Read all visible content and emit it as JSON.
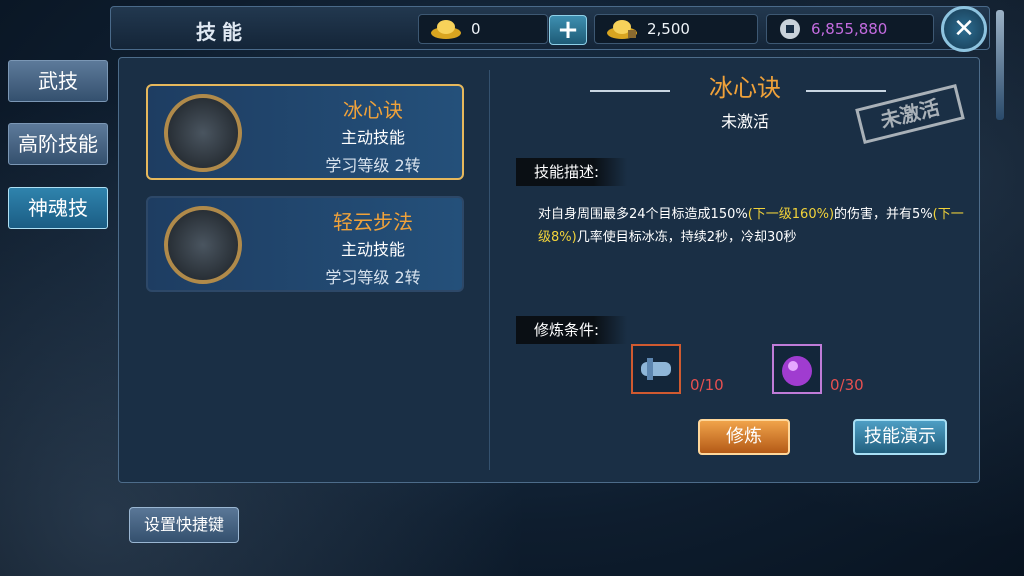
{
  "header": {
    "title": "技能"
  },
  "currency": {
    "ingot": "0",
    "bound_ingot": "2,500",
    "silver": "6,855,880"
  },
  "side_tabs": [
    {
      "label": "武技"
    },
    {
      "label": "高阶技能"
    },
    {
      "label": "神魂技"
    }
  ],
  "skills": [
    {
      "name": "冰心诀",
      "type": "主动技能",
      "level": "学习等级 2转"
    },
    {
      "name": "轻云步法",
      "type": "主动技能",
      "level": "学习等级 2转"
    }
  ],
  "detail": {
    "name": "冰心诀",
    "status": "未激活",
    "stamp": "未激活",
    "desc_label": "技能描述:",
    "desc_p1": "对自身周围最多24个目标造成150%",
    "desc_hl1": "(下一级160%)",
    "desc_p2": "的伤害，并有5%",
    "desc_hl2": "(下一级8%)",
    "desc_p3": "几率使目标冰冻，持续2秒，冷却30秒",
    "cond_label": "修炼条件:",
    "items": [
      {
        "count": "0/10"
      },
      {
        "count": "0/30"
      }
    ]
  },
  "buttons": {
    "train": "修炼",
    "demo": "技能演示",
    "hotkey": "设置快捷键"
  },
  "colors": {
    "accent": "#f0a23a",
    "highlight": "#f2d33a",
    "warning": "#e85050"
  }
}
